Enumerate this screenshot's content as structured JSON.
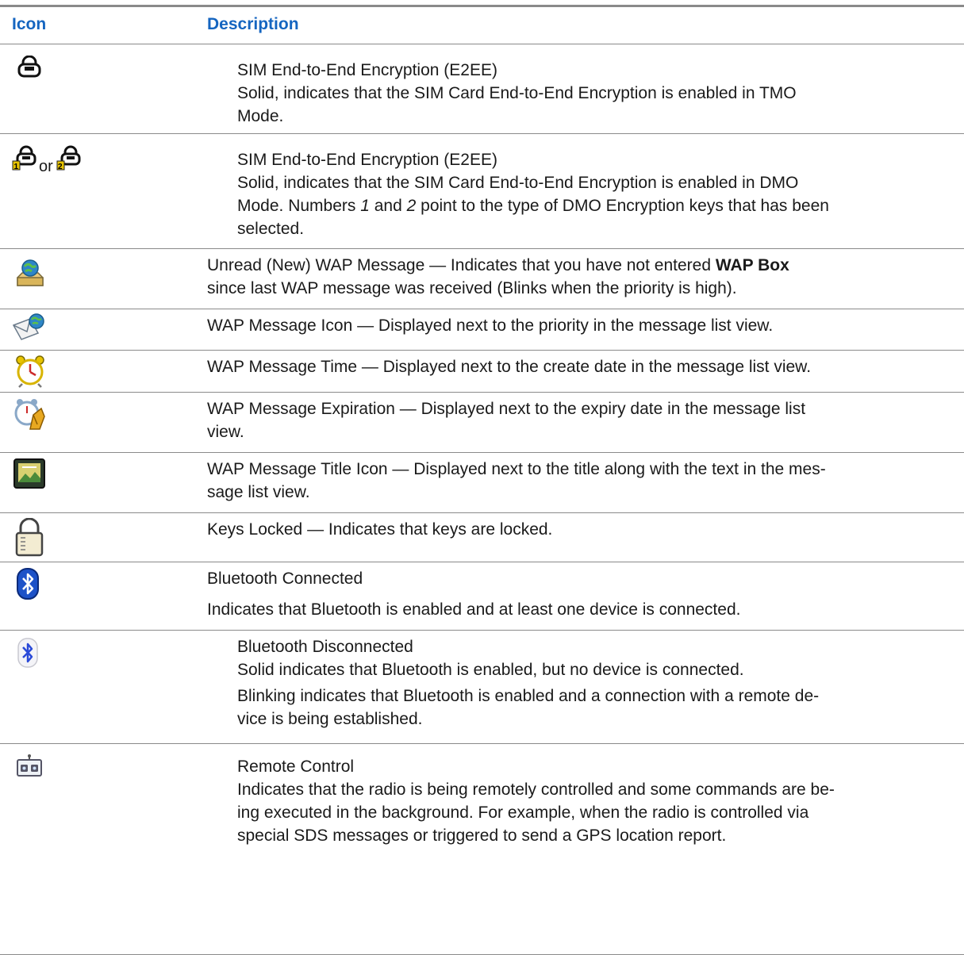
{
  "header": {
    "icon": "Icon",
    "description": "Description"
  },
  "rows": [
    {
      "icon": "sim-e2ee-tmo-icon",
      "lines": [
        "SIM End-to-End Encryption (E2EE)",
        "Solid, indicates that the SIM Card End-to-End Encryption is enabled in TMO",
        "Mode."
      ]
    },
    {
      "icon": "sim-e2ee-dmo-icon",
      "or_word": "or",
      "lines": [
        "SIM End-to-End Encryption (E2EE)",
        "Solid, indicates that the SIM Card End-to-End Encryption is enabled in DMO",
        "Mode. Numbers ",
        "1",
        " and ",
        "2",
        " point to the type of DMO Encryption keys that has been",
        "selected."
      ]
    },
    {
      "icon": "wap-unread-icon",
      "line1_pre": "Unread (New) WAP Message — Indicates that you have not entered ",
      "line1_bold": "WAP Box",
      "line2": "since last WAP message was received (Blinks when the priority is high)."
    },
    {
      "icon": "wap-message-icon",
      "lines": [
        "WAP Message Icon — Displayed next to the priority in the message list view."
      ]
    },
    {
      "icon": "alarm-clock-icon",
      "lines": [
        "WAP Message Time — Displayed next to the create date in the message list view."
      ]
    },
    {
      "icon": "wap-expiration-icon",
      "lines": [
        "WAP Message Expiration — Displayed next to the expiry date in the message list",
        "view."
      ]
    },
    {
      "icon": "wap-title-icon",
      "lines": [
        "WAP Message Title Icon — Displayed next to the title along with the text in the mes-",
        "sage list view."
      ]
    },
    {
      "icon": "keys-locked-icon",
      "lines": [
        "Keys Locked — Indicates that keys are locked."
      ]
    },
    {
      "icon": "bluetooth-connected-icon",
      "lines": [
        "Bluetooth Connected",
        "Indicates that Bluetooth is enabled and at least one device is connected."
      ]
    },
    {
      "icon": "bluetooth-disconnected-icon",
      "lines": [
        "Bluetooth Disconnected",
        "Solid indicates that Bluetooth is enabled, but no device is connected.",
        "Blinking indicates that Bluetooth is enabled and a connection with a remote de-",
        "vice is being established."
      ]
    },
    {
      "icon": "remote-control-icon",
      "lines": [
        "Remote Control",
        "Indicates that the radio is being remotely controlled and some commands are be-",
        "ing executed in the background. For example, when the radio is controlled via",
        "special SDS messages or triggered to send a GPS location report."
      ]
    }
  ]
}
